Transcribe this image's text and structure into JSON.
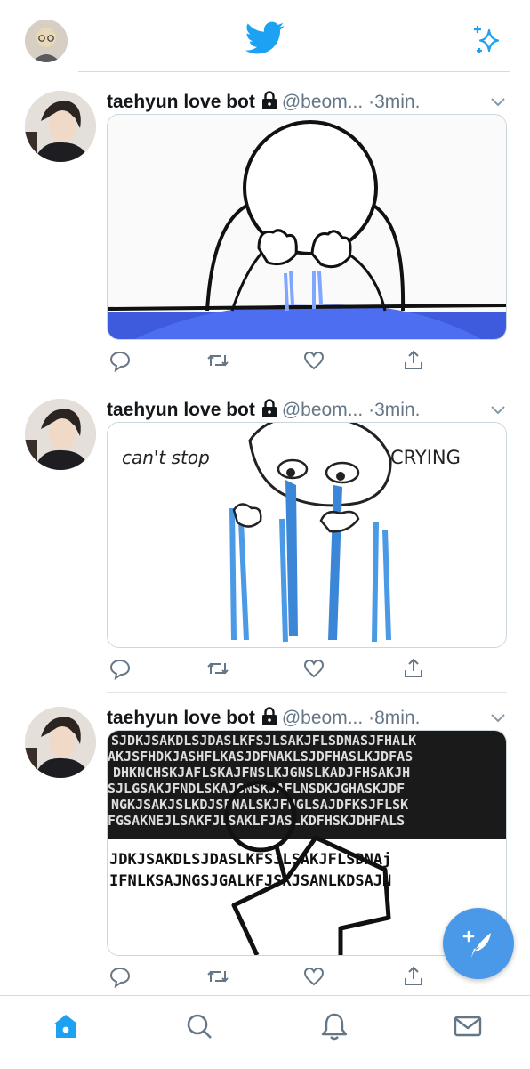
{
  "colors": {
    "brand": "#1da1f2",
    "accent": "#4a99e9",
    "muted": "#657786",
    "divider": "#e1e8ed"
  },
  "topbar": {
    "logo_icon": "twitter-bird-icon",
    "sparkle_icon": "sparkle-icon"
  },
  "tweets": [
    {
      "name": "taehyun love bot",
      "handle": "@beom...",
      "dot": "·",
      "time": "3min.",
      "media_caption": ""
    },
    {
      "name": "taehyun love bot",
      "handle": "@beom...",
      "dot": "·",
      "time": "3min.",
      "media_caption": {
        "left": "can't stop",
        "right": "CRYING"
      }
    },
    {
      "name": "taehyun love bot",
      "handle": "@beom...",
      "dot": "·",
      "time": "8min.",
      "media_caption": "",
      "media_text_lines": [
        "JDKJSAKDLSJDASLKFSJLSAKJFLSDNAj",
        "IFNLKSAJNGSJGALKFJSKJSANLKDSAJN"
      ]
    }
  ],
  "bottom_nav": [
    "home-icon",
    "search-icon",
    "notifications-icon",
    "messages-icon"
  ]
}
